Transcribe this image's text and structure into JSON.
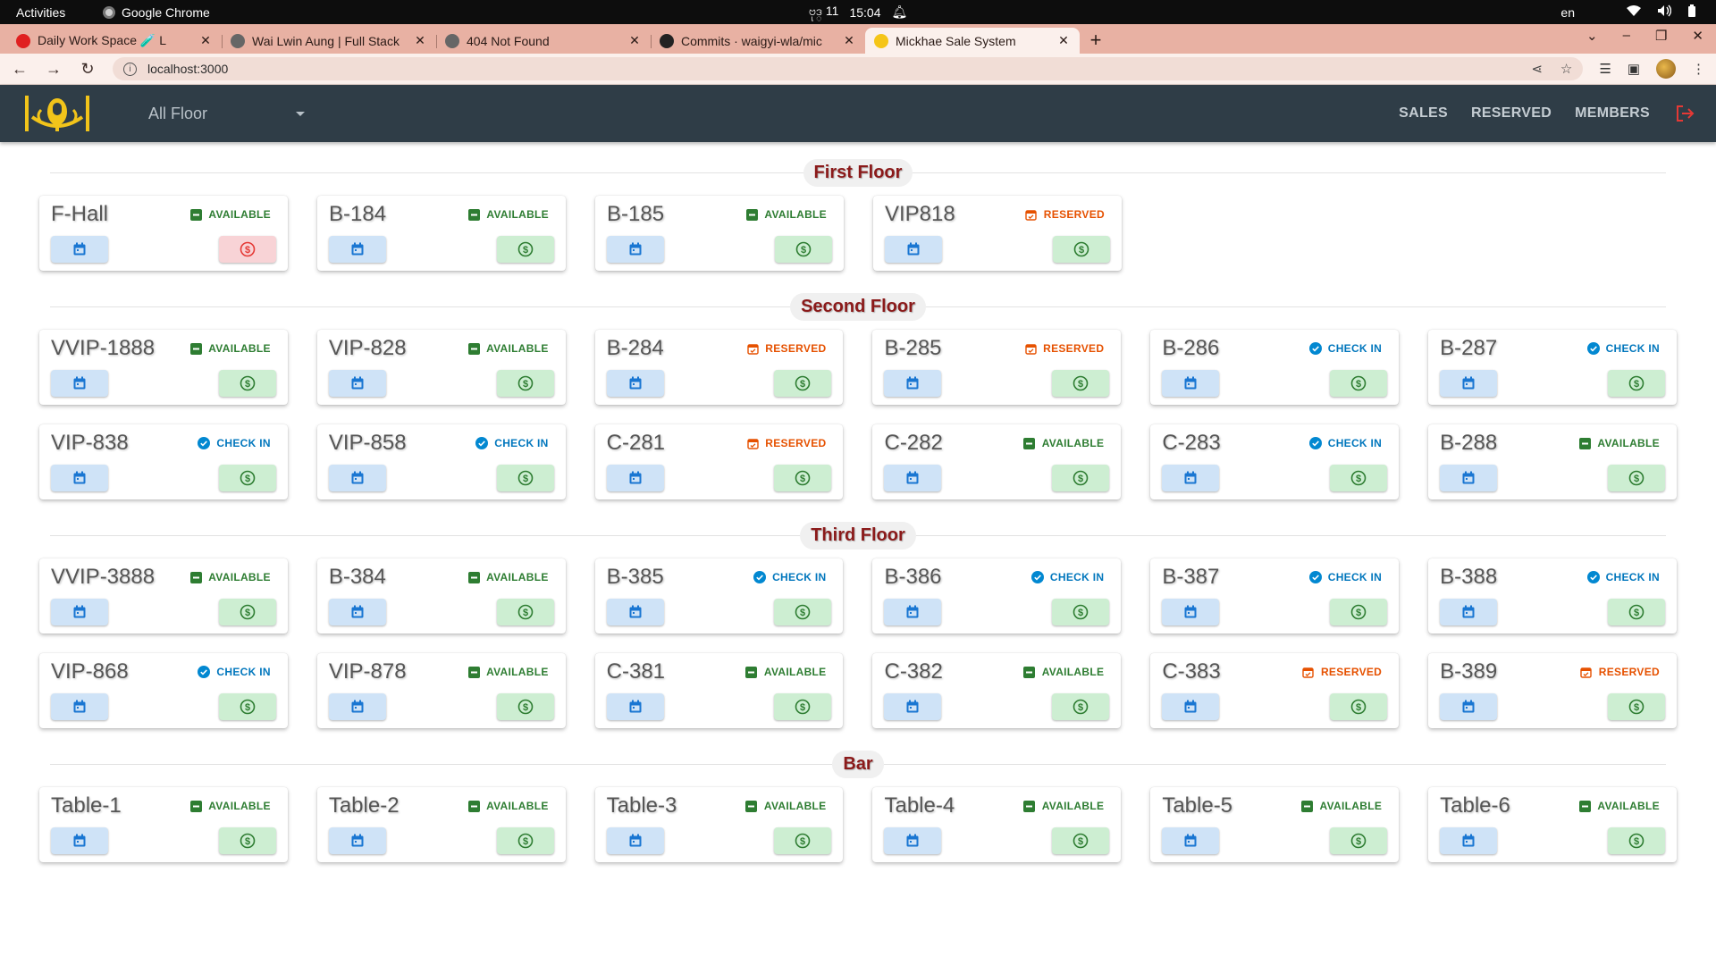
{
  "system": {
    "activities": "Activities",
    "app_name": "Google Chrome",
    "clock_day": "ဗုဒ္ 11",
    "clock_time": "15:04",
    "lang": "en"
  },
  "browser": {
    "tabs": [
      {
        "title": "Daily Work Space 🧪 L",
        "active": false,
        "fav_color": "#e02020"
      },
      {
        "title": "Wai Lwin Aung | Full Stack",
        "active": false,
        "fav_color": "#666666"
      },
      {
        "title": "404 Not Found",
        "active": false,
        "fav_color": "#666666"
      },
      {
        "title": "Commits · waigyi-wla/mic",
        "active": false,
        "fav_color": "#222222"
      },
      {
        "title": "Mickhae Sale System",
        "active": true,
        "fav_color": "#f5c518"
      }
    ],
    "url": "localhost:3000"
  },
  "app": {
    "floor_select": "All Floor",
    "nav": {
      "sales": "SALES",
      "reserved": "RESERVED",
      "members": "MEMBERS"
    },
    "colors": {
      "header": "#2f3d47",
      "available": "#2e7d32",
      "reserved": "#e65100",
      "checkin": "#0277bd",
      "logout": "#e53935"
    }
  },
  "status_labels": {
    "available": "AVAILABLE",
    "reserved": "RESERVED",
    "checkin": "CHECK IN"
  },
  "sections": [
    {
      "title": "First Floor",
      "rows": [
        [
          {
            "name": "F-Hall",
            "status": "available",
            "pay_alert": true
          },
          {
            "name": "B-184",
            "status": "available"
          },
          {
            "name": "B-185",
            "status": "available"
          },
          {
            "name": "VIP818",
            "status": "reserved"
          }
        ]
      ]
    },
    {
      "title": "Second Floor",
      "rows": [
        [
          {
            "name": "VVIP-1888",
            "status": "available"
          },
          {
            "name": "VIP-828",
            "status": "available"
          },
          {
            "name": "B-284",
            "status": "reserved"
          },
          {
            "name": "B-285",
            "status": "reserved"
          },
          {
            "name": "B-286",
            "status": "checkin"
          },
          {
            "name": "B-287",
            "status": "checkin"
          }
        ],
        [
          {
            "name": "VIP-838",
            "status": "checkin"
          },
          {
            "name": "VIP-858",
            "status": "checkin"
          },
          {
            "name": "C-281",
            "status": "reserved"
          },
          {
            "name": "C-282",
            "status": "available"
          },
          {
            "name": "C-283",
            "status": "checkin"
          },
          {
            "name": "B-288",
            "status": "available"
          }
        ]
      ]
    },
    {
      "title": "Third Floor",
      "rows": [
        [
          {
            "name": "VVIP-3888",
            "status": "available"
          },
          {
            "name": "B-384",
            "status": "available"
          },
          {
            "name": "B-385",
            "status": "checkin"
          },
          {
            "name": "B-386",
            "status": "checkin"
          },
          {
            "name": "B-387",
            "status": "checkin"
          },
          {
            "name": "B-388",
            "status": "checkin"
          }
        ],
        [
          {
            "name": "VIP-868",
            "status": "checkin"
          },
          {
            "name": "VIP-878",
            "status": "available"
          },
          {
            "name": "C-381",
            "status": "available"
          },
          {
            "name": "C-382",
            "status": "available"
          },
          {
            "name": "C-383",
            "status": "reserved"
          },
          {
            "name": "B-389",
            "status": "reserved"
          }
        ]
      ]
    },
    {
      "title": "Bar",
      "rows": [
        [
          {
            "name": "Table-1",
            "status": "available"
          },
          {
            "name": "Table-2",
            "status": "available"
          },
          {
            "name": "Table-3",
            "status": "available"
          },
          {
            "name": "Table-4",
            "status": "available"
          },
          {
            "name": "Table-5",
            "status": "available"
          },
          {
            "name": "Table-6",
            "status": "available"
          }
        ]
      ]
    }
  ]
}
